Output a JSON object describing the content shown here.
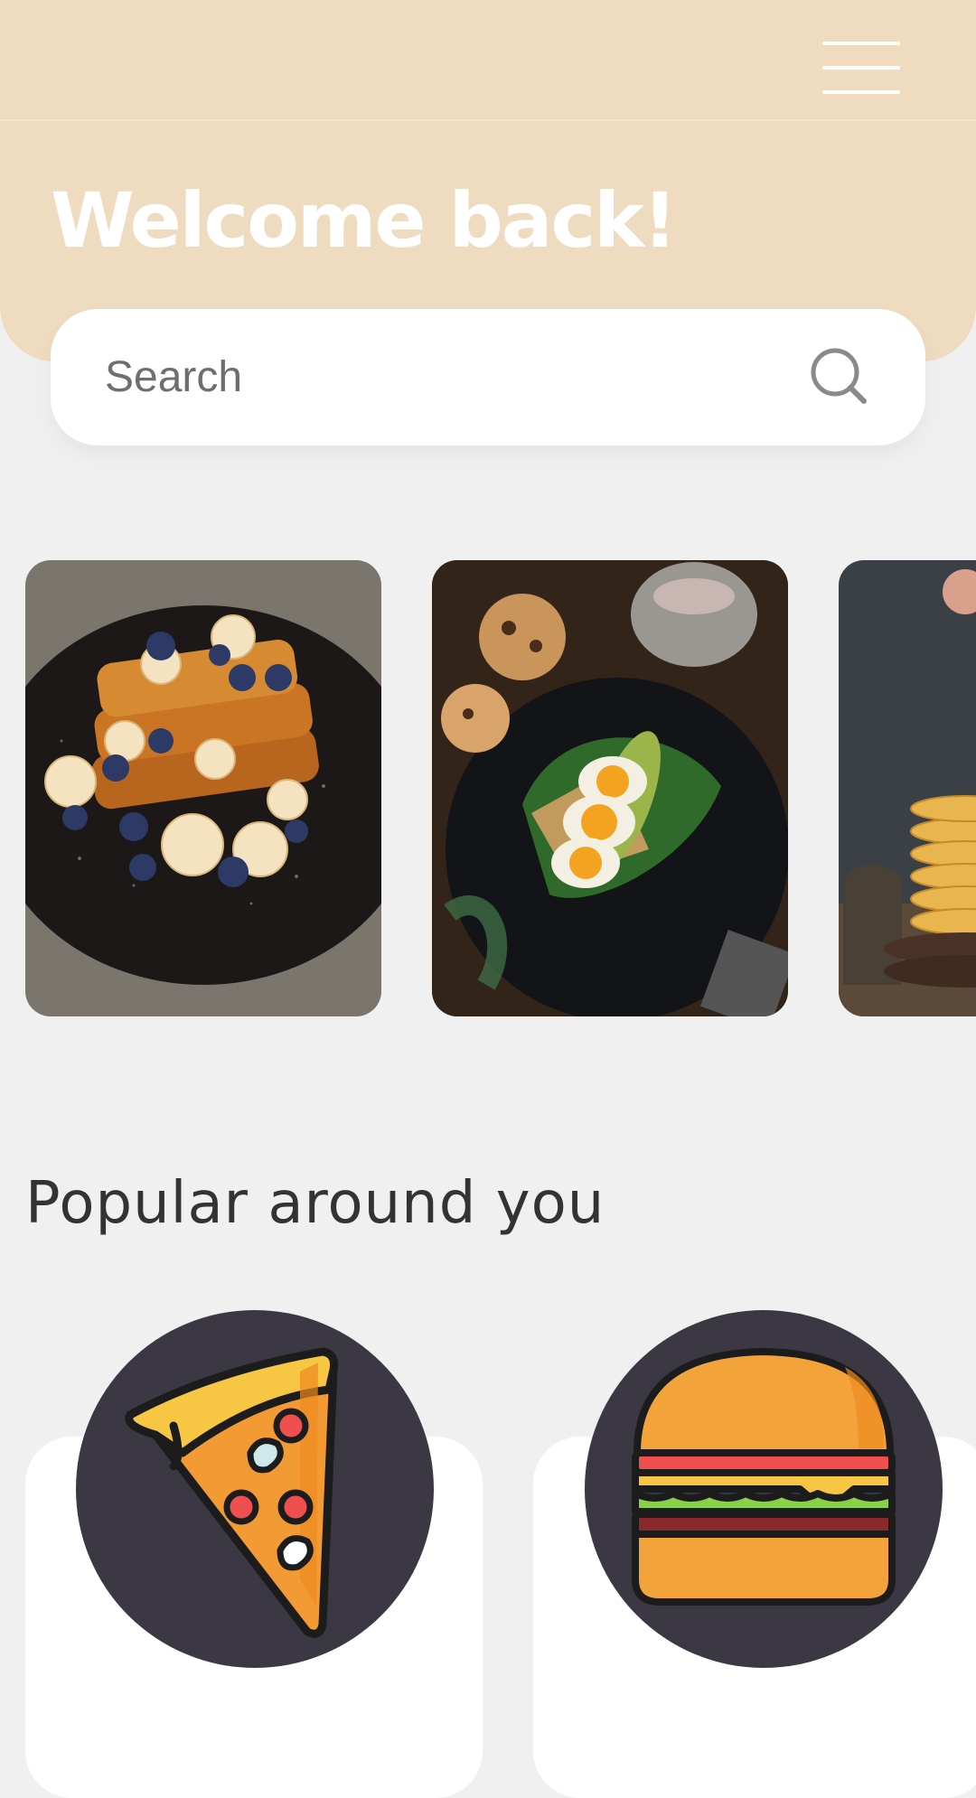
{
  "colors": {
    "accent": "#efdcc0",
    "background": "#f1f0f0",
    "icon_bg": "#3b3843"
  },
  "header": {
    "title": "Welcome back!",
    "menu_icon": "hamburger-menu-icon"
  },
  "search": {
    "placeholder": "Search",
    "icon": "search-icon"
  },
  "featured": [
    {
      "name": "french-toast-photo"
    },
    {
      "name": "egg-avocado-toast-photo"
    },
    {
      "name": "pancake-stack-photo"
    }
  ],
  "popular": {
    "title": "Popular around you",
    "items": [
      {
        "icon": "pizza-icon"
      },
      {
        "icon": "burger-icon"
      }
    ]
  }
}
